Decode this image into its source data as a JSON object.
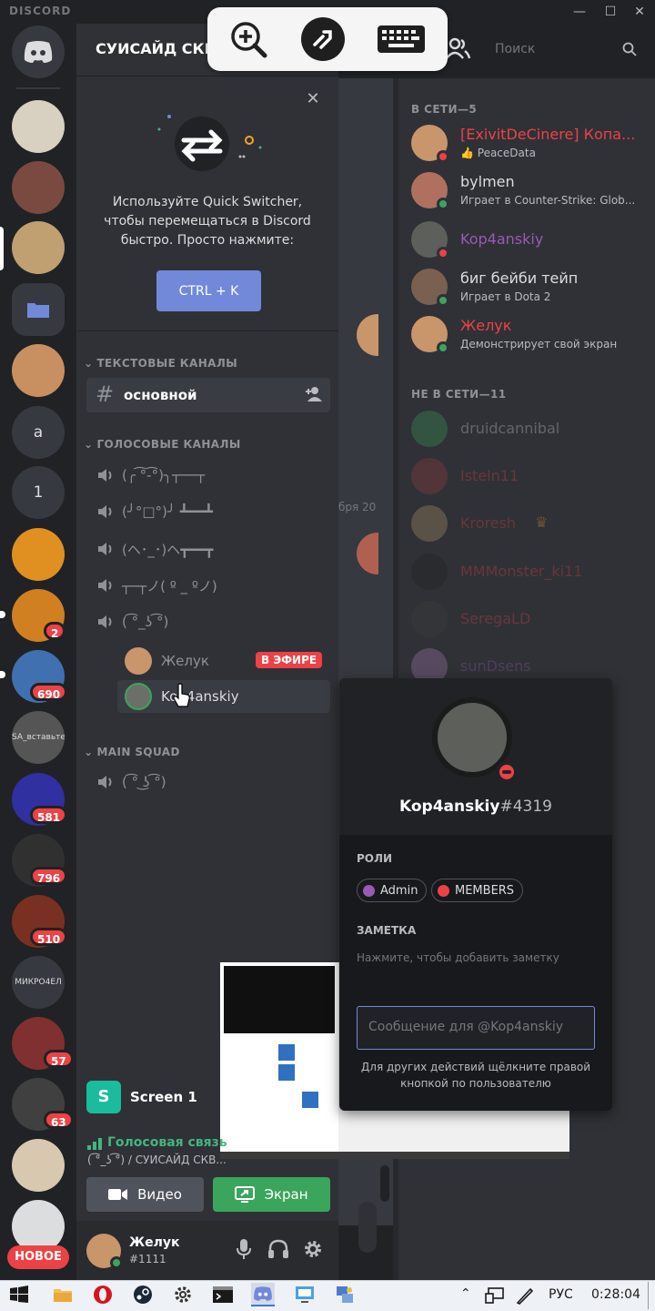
{
  "window": {
    "brand": "DISCORD",
    "minimize": "—",
    "maximize": "☐",
    "close": "✕"
  },
  "guild": {
    "name": "СУИСАЙД СКВАД"
  },
  "header": {
    "search_placeholder": "Поиск"
  },
  "servers": [
    {
      "name": "server-1",
      "color": "#d8d0c0"
    },
    {
      "name": "server-2",
      "color": "#7a4a40"
    },
    {
      "name": "server-3",
      "color": "#c0a070"
    },
    {
      "name": "server-folder",
      "color": "#36393f"
    },
    {
      "name": "server-5",
      "color": "#c89060"
    },
    {
      "name": "server-a",
      "label": "a"
    },
    {
      "name": "server-1-text",
      "label": "1"
    },
    {
      "name": "server-8",
      "color": "#e09020"
    },
    {
      "name": "server-9",
      "color": "#d08020",
      "badge": "2"
    },
    {
      "name": "server-10",
      "color": "#4070b0",
      "badge": "690"
    },
    {
      "name": "server-11",
      "color": "#555555",
      "label": "SA_вставьте"
    },
    {
      "name": "server-12",
      "color": "#3030a0",
      "badge": "581"
    },
    {
      "name": "server-13",
      "color": "#303030",
      "badge": "796"
    },
    {
      "name": "server-14",
      "color": "#7a3020",
      "badge": "510"
    },
    {
      "name": "server-15",
      "label": "МИКРО4ЕЛ"
    },
    {
      "name": "server-16",
      "color": "#803030",
      "badge": "57"
    },
    {
      "name": "server-17",
      "color": "#404040",
      "badge": "63"
    },
    {
      "name": "server-18",
      "color": "#d8c8b0"
    },
    {
      "name": "server-19",
      "color": "#dcddde"
    }
  ],
  "rail_new_label": "НОВОЕ",
  "promo": {
    "text": "Используйте Quick Switcher, чтобы перемещаться в Discord быстро. Просто нажмите:",
    "button": "CTRL + K"
  },
  "categories": {
    "text": "ТЕКСТОВЫЕ КАНАЛЫ",
    "voice": "ГОЛОСОВЫЕ КАНАЛЫ",
    "main": "MAIN SQUAD"
  },
  "text_channel": "основной",
  "voice_channels": [
    "(╭ ͡°-͡°)╮┬──┬",
    "(╯°□°)╯ ┻━━┻",
    "(ヘ･_･)ヘ┳━━┳",
    "┬─┬ノ( º _ ºノ)",
    "( ͡°_ʖ ͡°)"
  ],
  "voice_users": [
    {
      "name": "Желук",
      "live": "В ЭФИРЕ"
    },
    {
      "name": "Kop4anskiy"
    }
  ],
  "main_squad_channel": "( ͡° ͜ʖ ͡°)",
  "chat_fragments": {
    "date": "бря 20"
  },
  "members": {
    "online_header": "В СЕТИ—5",
    "offline_header": "НЕ В СЕТИ—11",
    "online": [
      {
        "name": "[ExivitDeCinere] Копа...",
        "activity": "👍 PeaceData",
        "color": "#ed4245",
        "status": "#ed4245"
      },
      {
        "name": "bylmen",
        "activity": "Играет в Counter-Strike: Glob...",
        "color": "#dcddde",
        "status": "#3ba55d"
      },
      {
        "name": "Kop4anskiy",
        "activity": "",
        "color": "#9b59b6",
        "status": "#ed4245"
      },
      {
        "name": "биг бейби тейп",
        "activity": "Играет в Dota 2",
        "color": "#dcddde",
        "status": "#3ba55d"
      },
      {
        "name": "Желук",
        "activity": "Демонстрирует свой экран",
        "color": "#ed4245",
        "status": "#3ba55d"
      }
    ],
    "offline": [
      {
        "name": "druidcannibal",
        "color": "#dcddde"
      },
      {
        "name": "Isteln11",
        "color": "#ed4245"
      },
      {
        "name": "Kroresh",
        "color": "#ed4245"
      },
      {
        "name": "MMMonster_ki11",
        "color": "#ed4245"
      },
      {
        "name": "SeregaLD",
        "color": "#ed4245"
      },
      {
        "name": "sunDsens",
        "color": "#9b59b6"
      }
    ]
  },
  "popout": {
    "username": "Kop4anskiy",
    "discriminator": "#4319",
    "roles_title": "РОЛИ",
    "roles": [
      {
        "name": "Admin",
        "color": "#9b59b6"
      },
      {
        "name": "MEMBERS",
        "color": "#ed4245"
      }
    ],
    "note_title": "ЗАМЕТКА",
    "note_placeholder": "Нажмите, чтобы добавить заметку",
    "message_placeholder": "Сообщение для @Kop4anskiy",
    "hint": "Для других действий щёлкните правой кнопкой по пользователю"
  },
  "stream": {
    "title": "Screen 1"
  },
  "voice_status": {
    "title": "Голосовая связь",
    "subtitle": "( ͡°_ʖ ͡°) / СУИСАЙД СКВ..."
  },
  "voice_buttons": {
    "video": "Видео",
    "screen": "Экран"
  },
  "user": {
    "name": "Желук",
    "tag": "#1111"
  },
  "taskbar": {
    "lang": "РУС",
    "time": "0:28:04"
  }
}
